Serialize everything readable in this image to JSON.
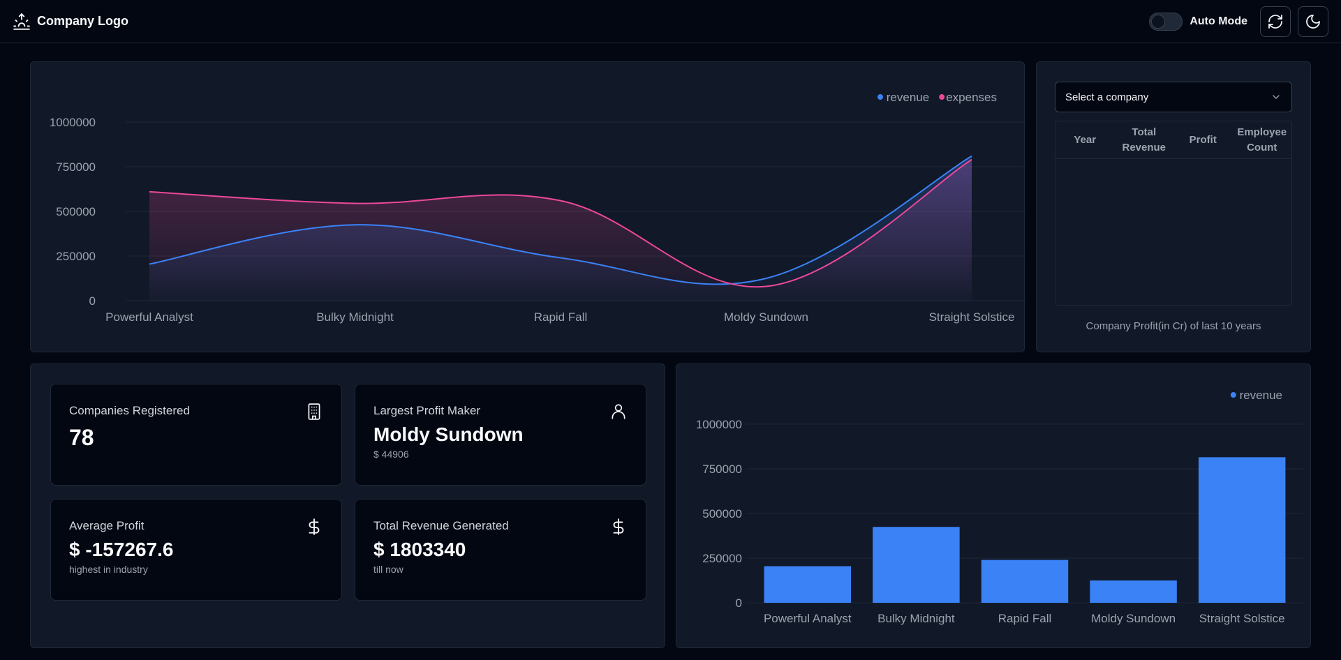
{
  "header": {
    "logo_text": "Company Logo",
    "auto_mode_label": "Auto Mode",
    "auto_mode_on": false
  },
  "line_chart": {
    "legend": [
      "revenue",
      "expenses"
    ]
  },
  "company_table": {
    "select_placeholder": "Select a company",
    "columns": [
      "Year",
      "Total Revenue",
      "Profit",
      "Employee Count"
    ],
    "rows": [],
    "caption": "Company Profit(in Cr) of last 10 years"
  },
  "stats": {
    "companies": {
      "label": "Companies Registered",
      "value": "78"
    },
    "largest": {
      "label": "Largest Profit Maker",
      "value": "Moldy Sundown",
      "sub": "$ 44906"
    },
    "average": {
      "label": "Average Profit",
      "value": "$ -157267.6",
      "sub": "highest in industry"
    },
    "total": {
      "label": "Total Revenue Generated",
      "value": "$ 1803340",
      "sub": "till now"
    }
  },
  "bar_chart": {
    "legend": [
      "revenue"
    ]
  },
  "colors": {
    "revenue": "#3b82f6",
    "expenses": "#ec4899",
    "background": "#030712",
    "card": "#111827"
  },
  "chart_data": [
    {
      "type": "line",
      "categories": [
        "Powerful Analyst",
        "Bulky Midnight",
        "Rapid Fall",
        "Moldy Sundown",
        "Straight Solstice"
      ],
      "series": [
        {
          "name": "revenue",
          "values": [
            205000,
            425000,
            240000,
            125000,
            810000
          ]
        },
        {
          "name": "expenses",
          "values": [
            610000,
            545000,
            560000,
            80000,
            790000
          ]
        }
      ],
      "yticks": [
        "0",
        "250000",
        "500000",
        "750000",
        "1000000"
      ],
      "ylim": [
        0,
        1000000
      ],
      "grid": true,
      "legend_position": "top-right"
    },
    {
      "type": "bar",
      "categories": [
        "Powerful Analyst",
        "Bulky Midnight",
        "Rapid Fall",
        "Moldy Sundown",
        "Straight Solstice"
      ],
      "series": [
        {
          "name": "revenue",
          "values": [
            205000,
            425000,
            240000,
            125000,
            815000
          ]
        }
      ],
      "yticks": [
        "0",
        "250000",
        "500000",
        "750000",
        "1000000"
      ],
      "ylim": [
        0,
        1000000
      ],
      "grid": true,
      "legend_position": "top-right"
    }
  ]
}
